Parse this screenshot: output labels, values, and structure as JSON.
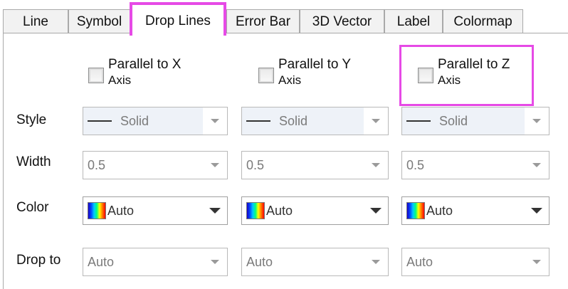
{
  "tabs": [
    {
      "label": "Line",
      "active": false
    },
    {
      "label": "Symbol",
      "active": false
    },
    {
      "label": "Drop Lines",
      "active": true
    },
    {
      "label": "Error Bar",
      "active": false
    },
    {
      "label": "3D Vector",
      "active": false
    },
    {
      "label": "Label",
      "active": false
    },
    {
      "label": "Colormap",
      "active": false
    }
  ],
  "checkboxes": [
    {
      "line1": "Parallel to X",
      "line2": "Axis",
      "checked": false
    },
    {
      "line1": "Parallel to Y",
      "line2": "Axis",
      "checked": false
    },
    {
      "line1": "Parallel to Z",
      "line2": "Axis",
      "checked": false
    }
  ],
  "rows": {
    "style": {
      "label": "Style",
      "values": [
        "Solid",
        "Solid",
        "Solid"
      ]
    },
    "width": {
      "label": "Width",
      "values": [
        "0.5",
        "0.5",
        "0.5"
      ]
    },
    "color": {
      "label": "Color",
      "values": [
        "Auto",
        "Auto",
        "Auto"
      ]
    },
    "drop_to": {
      "label": "Drop to",
      "values": [
        "Auto",
        "Auto",
        "Auto"
      ]
    }
  },
  "colors": {
    "highlight": "#e64ae6",
    "tab_bg": "#f2f2f2",
    "border": "#a9a9a9"
  }
}
